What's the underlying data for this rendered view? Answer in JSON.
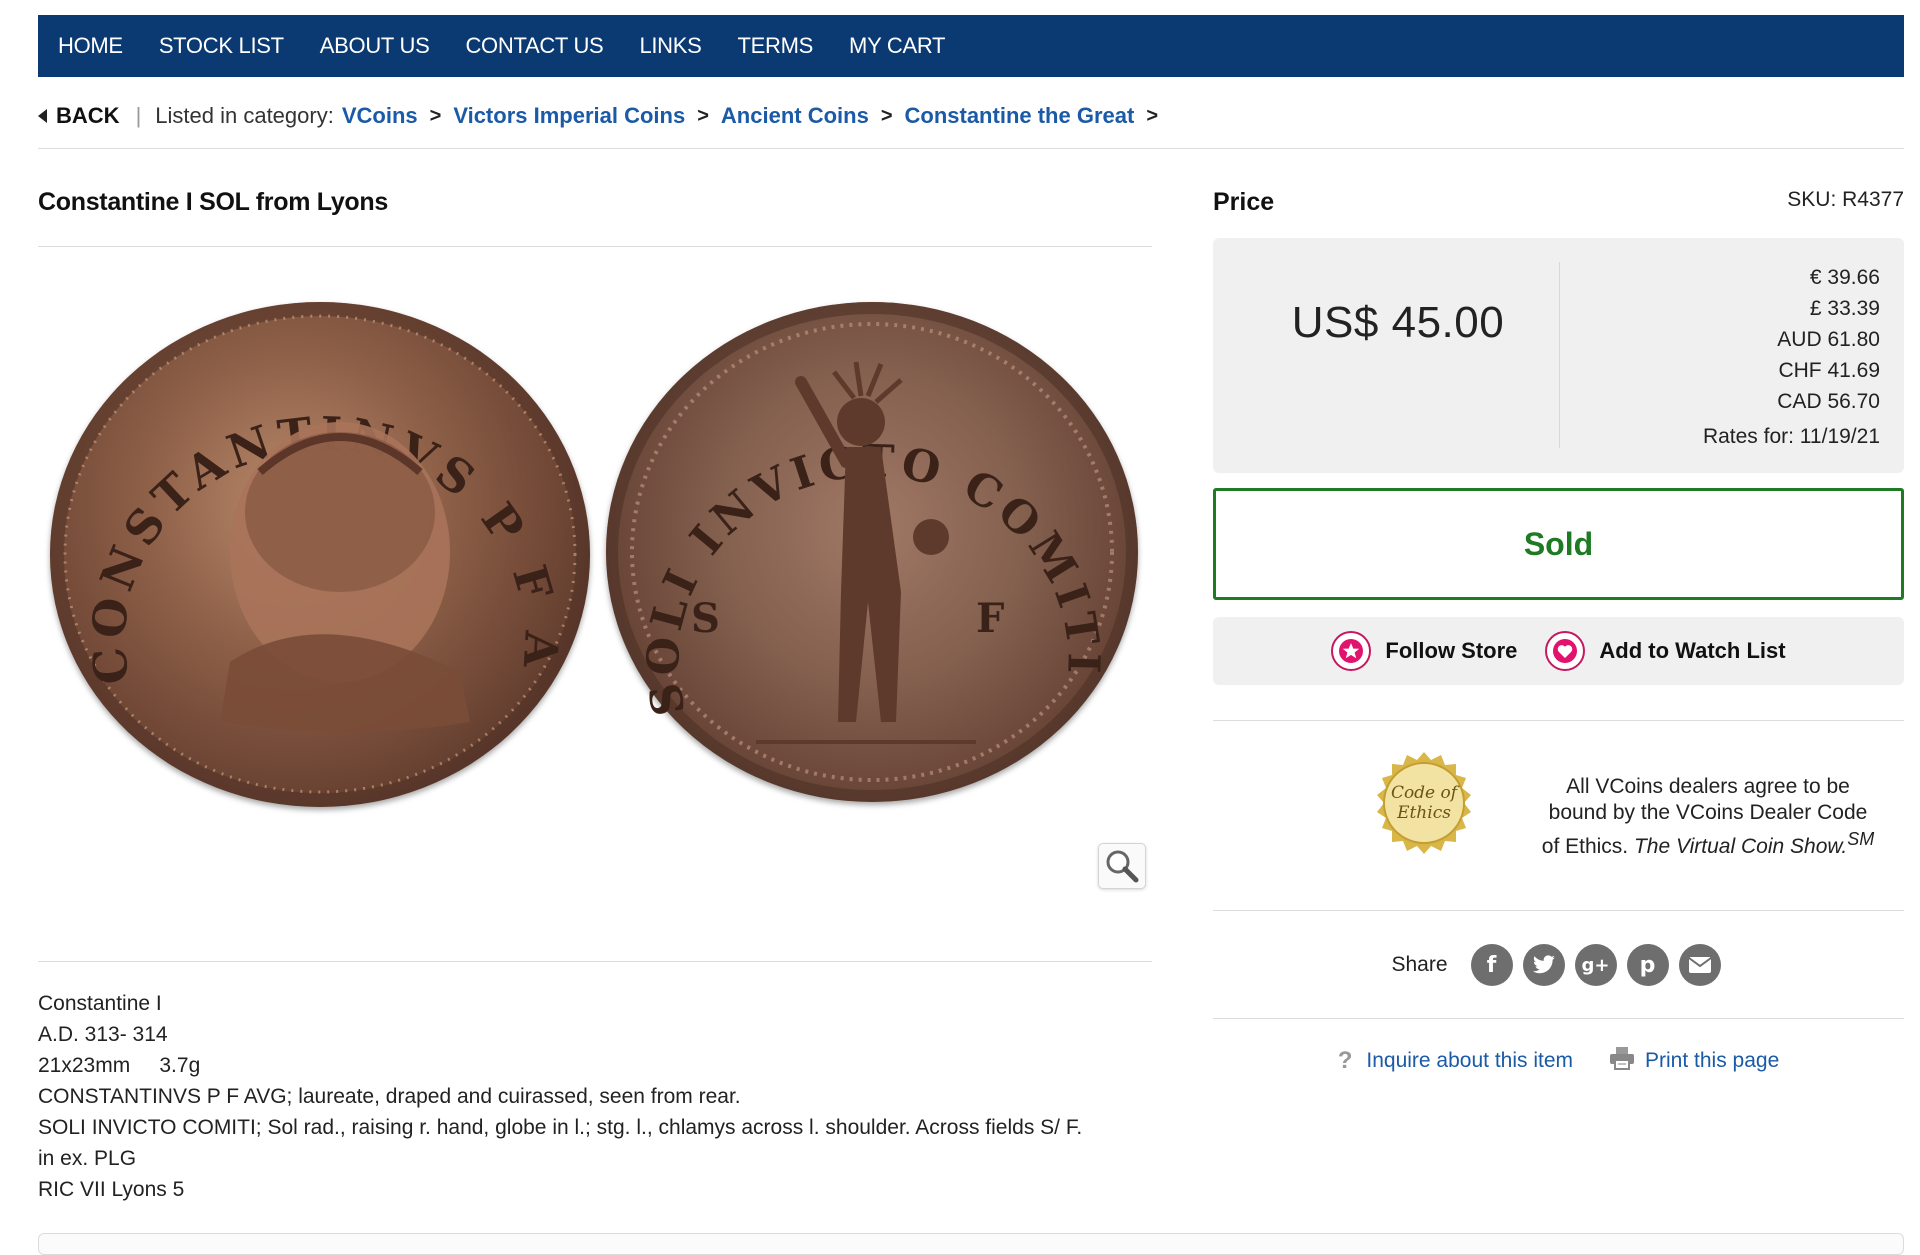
{
  "nav": {
    "items": [
      "HOME",
      "STOCK LIST",
      "ABOUT US",
      "CONTACT US",
      "LINKS",
      "TERMS",
      "MY CART"
    ]
  },
  "breadcrumb": {
    "back": "BACK",
    "listed_label": "Listed in category:",
    "links": [
      "VCoins",
      "Victors Imperial Coins",
      "Ancient Coins",
      "Constantine the Great"
    ],
    "separator": ">"
  },
  "product": {
    "title": "Constantine I SOL from Lyons",
    "description": [
      "Constantine I",
      "A.D. 313- 314",
      "21x23mm     3.7g",
      "CONSTANTINVS P F AVG; laureate, draped and cuirassed, seen from rear.",
      "SOLI INVICTO COMITI; Sol rad., raising r. hand, globe in l.; stg. l., chlamys across l. shoulder. Across fields S/ F.",
      "in ex. PLG",
      "RIC VII Lyons 5"
    ],
    "obverse_legend": "CONSTANTINVS P F AVG",
    "reverse_legend": "SOLI INVICTO COMITI",
    "reverse_field_left": "S",
    "reverse_field_right": "F"
  },
  "price": {
    "label": "Price",
    "sku": "SKU: R4377",
    "main": "US$ 45.00",
    "conversions": [
      "€ 39.66",
      "£ 33.39",
      "AUD 61.80",
      "CHF 41.69",
      "CAD 56.70"
    ],
    "rates_date": "Rates for: 11/19/21"
  },
  "status": {
    "sold_label": "Sold",
    "color": "#1e7a23"
  },
  "store_actions": {
    "follow_label": "Follow Store",
    "watch_label": "Add to Watch List",
    "icon_color": "#c4185f"
  },
  "ethics": {
    "seal_line1": "Code of",
    "seal_line2": "Ethics",
    "text": "All VCoins dealers agree to be bound by the VCoins Dealer Code of Ethics.",
    "italic": "The Virtual Coin Show.",
    "sup": "SM"
  },
  "share": {
    "label": "Share",
    "icons": [
      "facebook-icon",
      "twitter-icon",
      "google-plus-icon",
      "pinterest-icon",
      "email-icon"
    ]
  },
  "links": {
    "inquire": "Inquire about this item",
    "print": "Print this page"
  },
  "colors": {
    "nav_bg": "#0b3a73",
    "link": "#1b5aa6"
  }
}
